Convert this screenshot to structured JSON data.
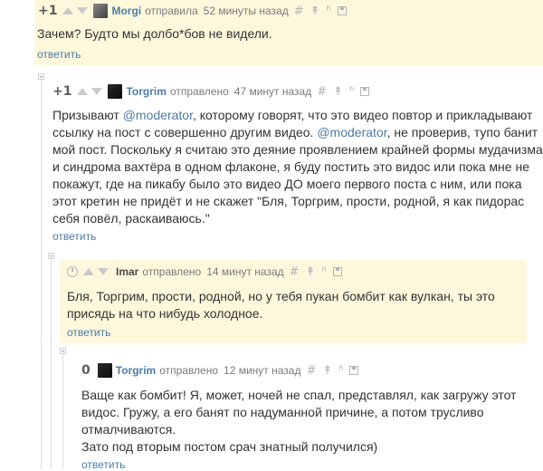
{
  "comments": [
    {
      "rating": "+1",
      "user": "Morgi",
      "action": "отправила",
      "time": "52 минуты назад",
      "text": "Зачем? Будто мы долбо*бов не видели.",
      "reply": "ответить"
    },
    {
      "rating": "+1",
      "user": "Torgrim",
      "action": "отправлено",
      "time": "47 минут назад",
      "text_1": "Призывают ",
      "mention_1": "@moderator",
      "text_2": ", которому говорят, что это видео повтор и прикладывают\nссылку на пост с совершенно другим видео. ",
      "mention_2": "@moderator",
      "text_3": ", не проверив, тупо банит\nмой пост. Поскольку я считаю это деяние проявлением крайней формы мудачизма\nи синдрома вахтёра в одном флаконе, я буду постить это видос или пока мне не\nпокажут, где на пикабу было это видео ДО моего первого поста с ним, или пока\nэтот кретин не придёт и не скажет \"Бля, Торгрим, прости, родной, я как пидорас\nсебя повёл, раскаиваюсь.\"",
      "reply": "ответить"
    },
    {
      "user": "Imar",
      "action": "отправлено",
      "time": "14 минут назад",
      "text": "Бля, Торгрим, прости, родной, но у тебя пукан бомбит как вулкан, ты это\nприсядь на что нибудь холодное.",
      "reply": "ответить"
    },
    {
      "rating": "0",
      "user": "Torgrim",
      "action": "отправлено",
      "time": "12 минут назад",
      "text": "Ваще как бомбит! Я, может, ночей не спал, представлял, как загружу этот\nвидос. Гружу, а его банят по надуманной причине, а потом трусливо\nотмалчиваются.\nЗато под вторым постом срач знатный получился)",
      "reply": "ответить"
    }
  ],
  "icons": {
    "link": "#",
    "pin": "↟",
    "branch": "ʱ",
    "save": "save-icon"
  }
}
